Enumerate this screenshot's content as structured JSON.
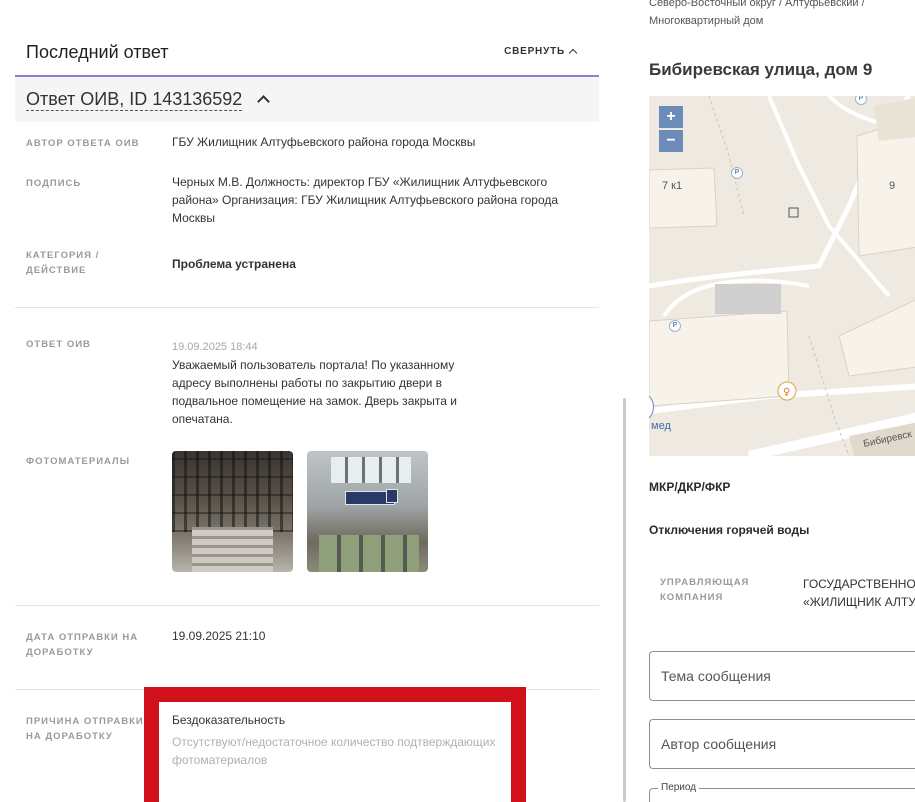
{
  "left": {
    "section_title": "Последний ответ",
    "collapse_label": "СВЕРНУТЬ",
    "answer_id": "Ответ ОИВ, ID 143136592",
    "author_label": "АВТОР ОТВЕТА ОИВ",
    "author_value": "ГБУ Жилищник Алтуфьевского района города Москвы",
    "signature_label": "ПОДПИСЬ",
    "signature_value": "Черных М.В. Должность: директор ГБУ «Жилищник Алтуфьевского района» Организация: ГБУ Жилищник Алтуфьевского района города Москвы",
    "category_label": "КАТЕГОРИЯ / ДЕЙСТВИЕ",
    "category_value": "Проблема устранена",
    "answer_label": "ОТВЕТ ОИВ",
    "answer_date": "19.09.2025 18:44",
    "answer_text": "Уважаемый пользователь портала! По указанному адресу выполнены работы по закрытию двери в подвальное помещение на замок. Дверь закрыта и опечатана.",
    "photos_label": "ФОТОМАТЕРИАЛЫ",
    "sent_date_label": "ДАТА ОТПРАВКИ НА ДОРАБОТКУ",
    "sent_date_value": "19.09.2025 21:10",
    "reason_label": "ПРИЧИНА ОТПРАВКИ НА ДОРАБОТКУ",
    "reason_value": "Бездоказательность",
    "reason_detail": "Отсутствуют/недостаточное количество подтверждающих фотоматериалов"
  },
  "right": {
    "breadcrumb_1": "Северо-Восточный округ / Алтуфьевский /",
    "breadcrumb_2": "Многоквартирный дом",
    "address": "Бибиревская улица, дом 9",
    "map": {
      "zoom_in": "+",
      "zoom_out": "−",
      "label_7k1": "7 к1",
      "label_9": "9",
      "label_med": "мед",
      "label_street": "Бибиревск",
      "parking": "P"
    },
    "mkr_heading": "МКР/ДКР/ФКР",
    "hot_water_heading": "Отключения горячей воды",
    "mgmt_label": "УПРАВЛЯЮЩАЯ КОМПАНИЯ",
    "mgmt_value_1": "ГОСУДАРСТВЕННОЕ БЮДЖЕТНОЕ",
    "mgmt_value_2": "«ЖИЛИЩНИК АЛТУФЬЕВСКОГО",
    "subject_placeholder": "Тема сообщения",
    "author_placeholder": "Автор сообщения",
    "period_label": "Период"
  },
  "colors": {
    "accent": "#8b7fd4",
    "highlight": "#d0101a",
    "map_zoom": "#6c8bb8"
  }
}
